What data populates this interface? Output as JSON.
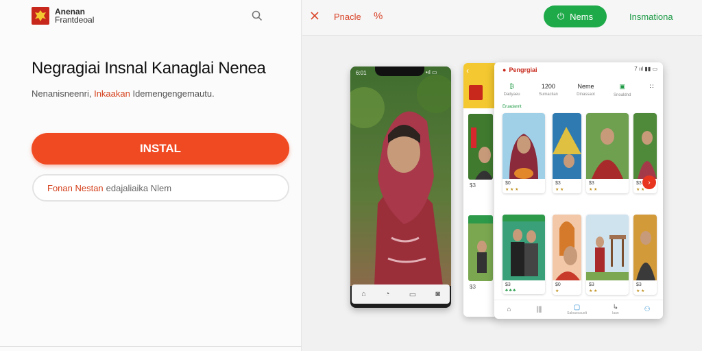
{
  "brand": {
    "line1": "Anenan",
    "line2": "Frantdeoal"
  },
  "main": {
    "headline": "Negragiai Insnal Kanaglai Nenea",
    "subline_a": "Nenanisneenri,",
    "subline_b": "Inkaakan",
    "subline_c": "Idemengengemautu.",
    "install_label": "INSTAL",
    "secondary_a": "Fonan Nestan",
    "secondary_b": "edajaliaika Nlem"
  },
  "topbar": {
    "close_icon": "close-icon",
    "practice_label": "Pnacle",
    "percent_label": "%",
    "news_label": "Nems",
    "info_label": "Insmationa"
  },
  "phone1": {
    "status_time": "6:01",
    "signal": "•ıl ▭"
  },
  "phone2": {
    "captions": [
      "$3",
      "$3"
    ]
  },
  "phone3": {
    "title": "Pengrgiai",
    "status": "7 ııl ▮▮ ▭",
    "stats": [
      {
        "value": "₿",
        "label": "Dadyaeu"
      },
      {
        "value": "1200",
        "label": "Sumaclian"
      },
      {
        "value": "Neme",
        "label": "Dinassaot"
      },
      {
        "value": "▣",
        "label": "Snoaldnd"
      },
      {
        "value": "∷",
        "label": ""
      }
    ],
    "tag": "Eruadanrit",
    "cards_row1": [
      "$0",
      "$3",
      "$3",
      "$3"
    ],
    "cards_row2": [
      "$3",
      "$0",
      "$3",
      "$3"
    ],
    "nav": [
      {
        "icon": "⌂",
        "label": ""
      },
      {
        "icon": "|||",
        "label": ""
      },
      {
        "icon": "▢",
        "label": "Saloaocauolt"
      },
      {
        "icon": "↳",
        "label": "Iaun"
      },
      {
        "icon": "⚇",
        "label": ""
      }
    ]
  },
  "colors": {
    "accent": "#f04a22",
    "green": "#1faa4a",
    "brand_red": "#c8281b"
  }
}
